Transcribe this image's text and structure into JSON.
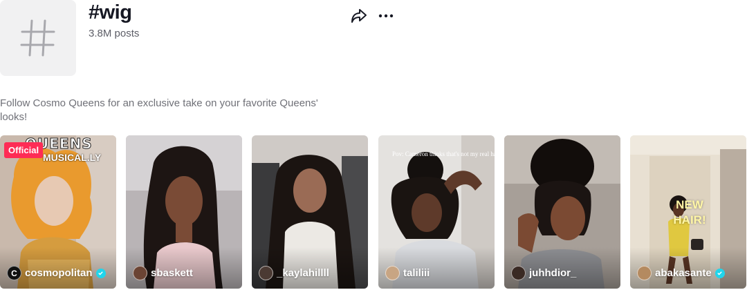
{
  "header": {
    "title": "#wig",
    "posts_count": "3.8M posts",
    "hash_glyph": "#"
  },
  "description": "Follow Cosmo Queens for an exclusive take on your favorite Queens' looks!",
  "videos": [
    {
      "author": "cosmopolitan",
      "verified": true,
      "badge": "Official",
      "overlay_line1": "QUEENS",
      "overlay_line2": "MUSICAL.LY"
    },
    {
      "author": "sbaskett",
      "verified": false
    },
    {
      "author": "_kaylahillll",
      "verified": false
    },
    {
      "author": "taliliii",
      "verified": false,
      "overlay_caption": "Pov: Cameron thinks that's not my real hair?"
    },
    {
      "author": "juhhdior_",
      "verified": false
    },
    {
      "author": "abakasante",
      "verified": true,
      "overlay_line1": "NEW",
      "overlay_line2": "HAIR!"
    }
  ],
  "colors": {
    "badge": "#fe2c55",
    "verified": "#20d5ec",
    "muted_text": "#6f7077"
  },
  "icons": [
    "hashtag-icon",
    "share-icon",
    "more-icon",
    "verified-icon"
  ]
}
